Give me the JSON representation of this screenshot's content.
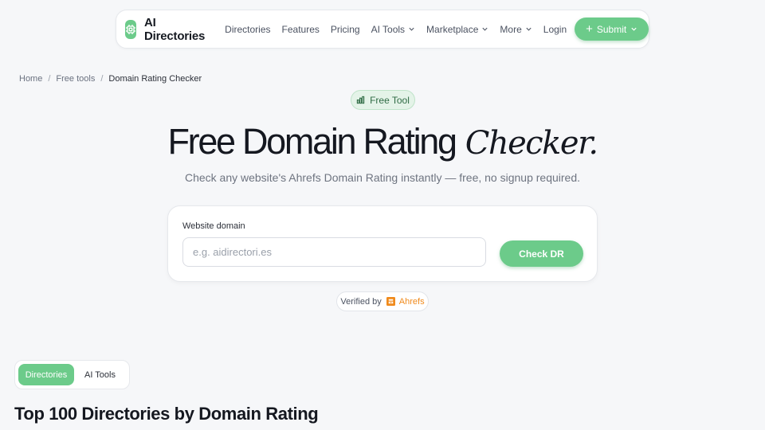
{
  "nav": {
    "brand": "AI Directories",
    "links": [
      "Directories",
      "Features",
      "Pricing",
      "AI Tools",
      "Marketplace",
      "More"
    ],
    "login": "Login",
    "submit": "Submit"
  },
  "breadcrumb": [
    "Home",
    "Free tools",
    "Domain Rating Checker"
  ],
  "badge": "Free Tool",
  "hero": {
    "title": "Free Domain Rating",
    "title_accent": "Checker.",
    "subtitle": "Check any website's Ahrefs Domain Rating instantly — free, no signup required."
  },
  "form": {
    "label": "Website domain",
    "placeholder": "e.g. aidirectori.es",
    "value": "",
    "button": "Check DR"
  },
  "verified": {
    "prefix": "Verified by",
    "brand": "Ahrefs"
  },
  "tabs": [
    "Directories",
    "AI Tools"
  ],
  "section_title": "Top 100 Directories by Domain Rating",
  "colors": {
    "accent": "#6ccb8a",
    "ahrefs": "#f08a1c",
    "background": "#f6f7f9"
  }
}
